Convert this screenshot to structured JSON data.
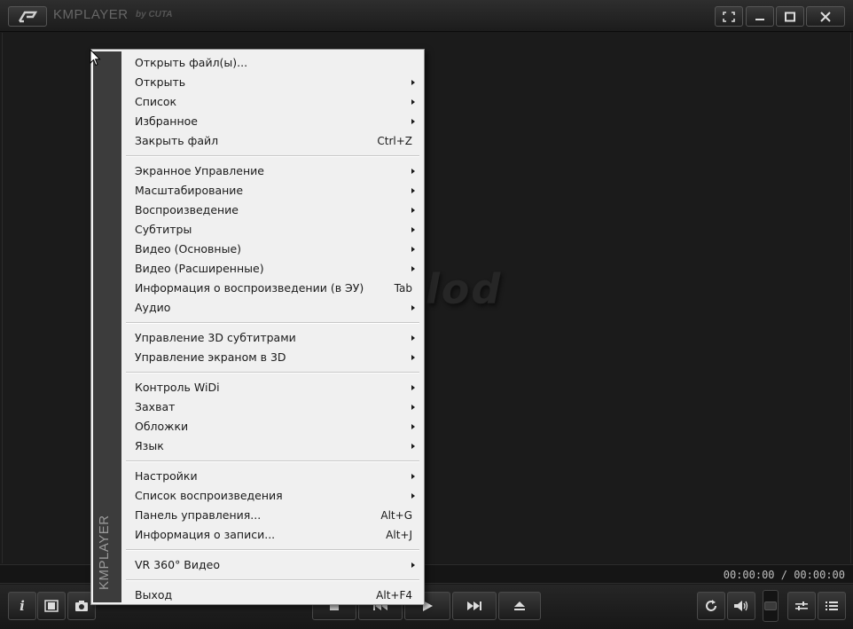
{
  "titlebar": {
    "title": "KMPLAYER",
    "subtitle": "by CUTA"
  },
  "video": {
    "watermark": "lod"
  },
  "seekbar": {
    "time": "00:00:00 / 00:00:00"
  },
  "menu": {
    "strip_label": "KMPLAYER",
    "groups": [
      [
        {
          "label": "Открыть файл(ы)...",
          "shortcut": "",
          "submenu": false
        },
        {
          "label": "Открыть",
          "shortcut": "",
          "submenu": true
        },
        {
          "label": "Список",
          "shortcut": "",
          "submenu": true
        },
        {
          "label": "Избранное",
          "shortcut": "",
          "submenu": true
        },
        {
          "label": "Закрыть файл",
          "shortcut": "Ctrl+Z",
          "submenu": false
        }
      ],
      [
        {
          "label": "Экранное Управление",
          "shortcut": "",
          "submenu": true
        },
        {
          "label": "Масштабирование",
          "shortcut": "",
          "submenu": true
        },
        {
          "label": "Воспроизведение",
          "shortcut": "",
          "submenu": true
        },
        {
          "label": "Субтитры",
          "shortcut": "",
          "submenu": true
        },
        {
          "label": "Видео (Основные)",
          "shortcut": "",
          "submenu": true
        },
        {
          "label": "Видео (Расширенные)",
          "shortcut": "",
          "submenu": true
        },
        {
          "label": "Информация о воспроизведении (в ЭУ)",
          "shortcut": "Tab",
          "submenu": false
        },
        {
          "label": "Аудио",
          "shortcut": "",
          "submenu": true
        }
      ],
      [
        {
          "label": "Управление 3D субтитрами",
          "shortcut": "",
          "submenu": true
        },
        {
          "label": "Управление экраном в 3D",
          "shortcut": "",
          "submenu": true
        }
      ],
      [
        {
          "label": "Контроль WiDi",
          "shortcut": "",
          "submenu": true
        },
        {
          "label": "Захват",
          "shortcut": "",
          "submenu": true
        },
        {
          "label": "Обложки",
          "shortcut": "",
          "submenu": true
        },
        {
          "label": "Язык",
          "shortcut": "",
          "submenu": true
        }
      ],
      [
        {
          "label": "Настройки",
          "shortcut": "",
          "submenu": true
        },
        {
          "label": "Список воспроизведения",
          "shortcut": "",
          "submenu": true
        },
        {
          "label": "Панель управления...",
          "shortcut": "Alt+G",
          "submenu": false
        },
        {
          "label": "Информация о записи...",
          "shortcut": "Alt+J",
          "submenu": false
        }
      ],
      [
        {
          "label": "VR 360° Видео",
          "shortcut": "",
          "submenu": true
        }
      ],
      [
        {
          "label": "Выход",
          "shortcut": "Alt+F4",
          "submenu": false
        }
      ]
    ]
  },
  "controls": {
    "info_label": "i"
  },
  "icons": {
    "logo": "kmplayer-logo-icon",
    "fullscreen": "fullscreen-icon",
    "minimize": "minimize-icon",
    "maximize": "maximize-icon",
    "close": "close-icon",
    "film": "film-icon",
    "camera": "camera-icon",
    "stop": "stop-icon",
    "prev": "previous-icon",
    "play": "play-icon",
    "next": "next-icon",
    "eject": "eject-icon",
    "repeat": "repeat-icon",
    "volume": "volume-icon",
    "equalizer": "equalizer-icon",
    "playlist": "playlist-icon"
  }
}
